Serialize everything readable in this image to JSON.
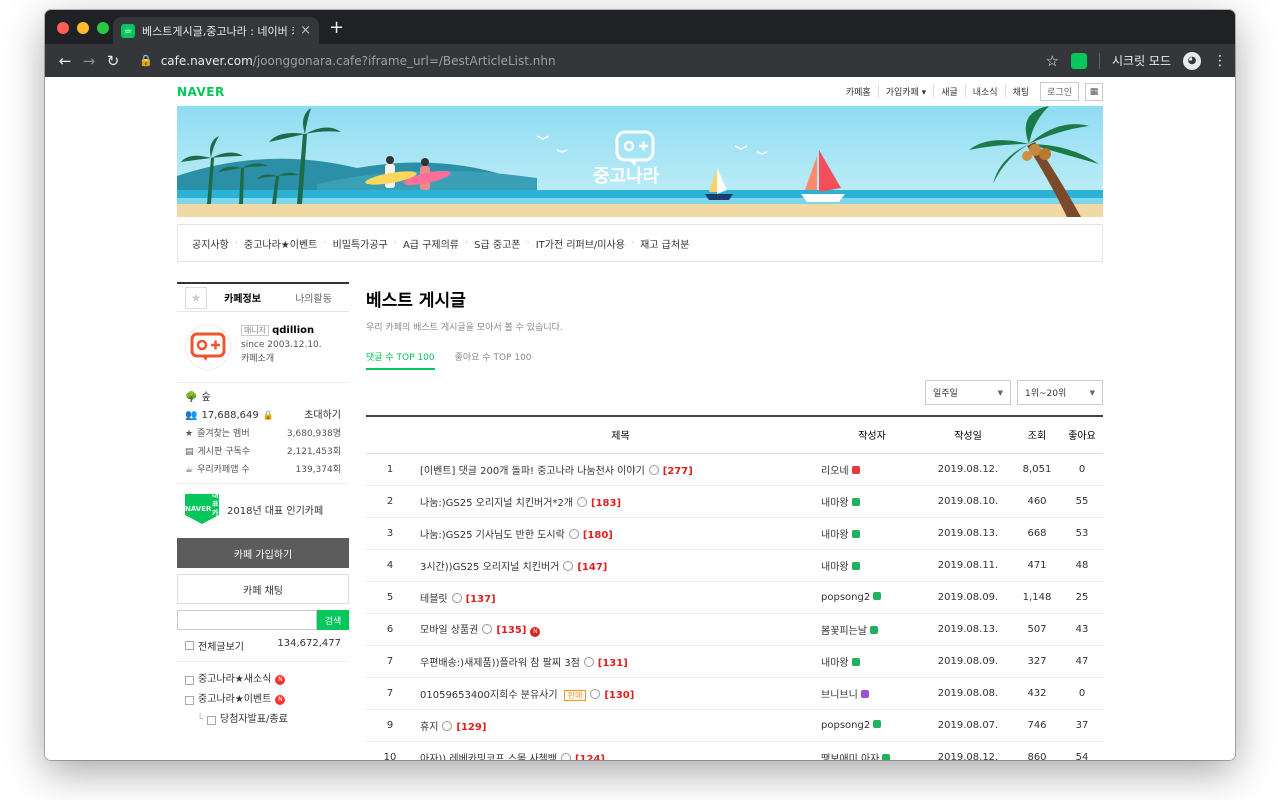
{
  "browser": {
    "tab_title": "베스트게시글,중고나라 : 네이버 카페",
    "tab_close": "×",
    "new_tab": "+",
    "url_host": "cafe.naver.com",
    "url_path": "/joonggonara.cafe?iframe_url=/BestArticleList.nhn",
    "profile_label": "시크릿 모드"
  },
  "gnb": {
    "logo": "NAVER",
    "items": [
      "카페홈",
      "가입카페 ▾",
      "새글",
      "내소식",
      "채팅"
    ],
    "login": "로그인"
  },
  "banner": {
    "logo_text": "중고나라"
  },
  "menubar": [
    "공지사항",
    "중고나라★이벤트",
    "비밀특가공구",
    "A급 구제의류",
    "S급 중고폰",
    "IT가전 리퍼브/미사용",
    "재고 급처분"
  ],
  "sidebar": {
    "tab_info": "카페정보",
    "tab_activity": "나의활동",
    "manager_badge": "매니저",
    "manager_name": "qdillion",
    "since": "since 2003.12.10.",
    "intro": "카페소개",
    "level": "숲",
    "members": "17,688,649",
    "invite": "초대하기",
    "stats": [
      {
        "label": "즐겨찾는 멤버",
        "value": "3,680,938명"
      },
      {
        "label": "게시판 구독수",
        "value": "2,121,453회"
      },
      {
        "label": "우리카페앱 수",
        "value": "139,374회"
      }
    ],
    "award_badge_top": "NAVER",
    "award_badge_bottom": "대표카페",
    "award": "2018년 대표 인기카페",
    "join": "카페 가입하기",
    "chat": "카페 채팅",
    "search_placeholder": "",
    "search_button": "검색",
    "all_posts_label": "전체글보기",
    "all_posts_count": "134,672,477",
    "boards": [
      {
        "label": "중고나라★새소식",
        "new": "N"
      },
      {
        "label": "중고나라★이벤트",
        "new": "N"
      },
      {
        "label": "당첨자발표/종료",
        "new": ""
      }
    ]
  },
  "main": {
    "title": "베스트 게시글",
    "desc": "우리 카페의 베스트 게시글을 모아서 볼 수 있습니다.",
    "tab_comments": "댓글 수 TOP 100",
    "tab_likes": "좋아요 수 TOP 100",
    "filter_period": "일주일",
    "filter_range": "1위~20위",
    "columns": [
      "제목",
      "작성자",
      "작성일",
      "조회",
      "좋아요"
    ],
    "rows": [
      {
        "no": "1",
        "title": "[이벤트] 댓글 200개 돌파! 중고나라 나눔천사 이야기",
        "comments": "[277]",
        "new": "",
        "sale": "",
        "author": "리오네",
        "level_color": "#e03a3a",
        "date": "2019.08.12.",
        "views": "8,051",
        "likes": "0"
      },
      {
        "no": "2",
        "title": "나눔:)GS25 오리지널 치킨버거*2개",
        "comments": "[183]",
        "new": "",
        "sale": "",
        "author": "내마왕",
        "level_color": "#20b25a",
        "date": "2019.08.10.",
        "views": "460",
        "likes": "55"
      },
      {
        "no": "3",
        "title": "나눔:)GS25 기사님도 반한 도시락",
        "comments": "[180]",
        "new": "",
        "sale": "",
        "author": "내마왕",
        "level_color": "#20b25a",
        "date": "2019.08.13.",
        "views": "668",
        "likes": "53"
      },
      {
        "no": "4",
        "title": "3시간))GS25 오리지널 치킨버거",
        "comments": "[147]",
        "new": "",
        "sale": "",
        "author": "내마왕",
        "level_color": "#20b25a",
        "date": "2019.08.11.",
        "views": "471",
        "likes": "48"
      },
      {
        "no": "5",
        "title": "테블릿",
        "comments": "[137]",
        "new": "",
        "sale": "",
        "author": "popsong2",
        "level_color": "#20b25a",
        "date": "2019.08.09.",
        "views": "1,148",
        "likes": "25"
      },
      {
        "no": "6",
        "title": "모바일 상품권",
        "comments": "[135]",
        "new": "N",
        "sale": "",
        "author": "봄꽃피는날",
        "level_color": "#20b25a",
        "date": "2019.08.13.",
        "views": "507",
        "likes": "43"
      },
      {
        "no": "7",
        "title": "우편배송:)새제품))플라워 참 팔찌 3점",
        "comments": "[131]",
        "new": "",
        "sale": "",
        "author": "내마왕",
        "level_color": "#20b25a",
        "date": "2019.08.09.",
        "views": "327",
        "likes": "47"
      },
      {
        "no": "7",
        "title": "01059653400지희수 분유사기",
        "comments": "[130]",
        "new": "",
        "sale": "판매",
        "author": "브니브니",
        "level_color": "#a050d8",
        "date": "2019.08.08.",
        "views": "432",
        "likes": "0"
      },
      {
        "no": "9",
        "title": "휴지",
        "comments": "[129]",
        "new": "",
        "sale": "",
        "author": "popsong2",
        "level_color": "#20b25a",
        "date": "2019.08.07.",
        "views": "746",
        "likes": "37"
      },
      {
        "no": "10",
        "title": "아자)) 레베카밍코프 스몰 사첼백",
        "comments": "[124]",
        "new": "",
        "sale": "",
        "author": "땡보애미 아자",
        "level_color": "#20b25a",
        "date": "2019.08.12.",
        "views": "860",
        "likes": "54"
      }
    ]
  }
}
